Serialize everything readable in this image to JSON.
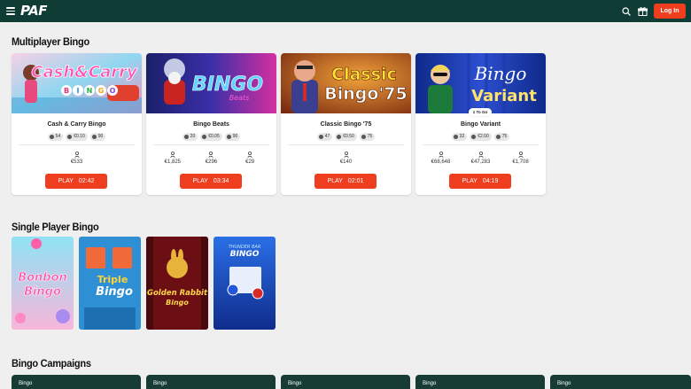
{
  "header": {
    "logo_text": "PAF",
    "login_label": "Log In",
    "icons": [
      "menu-icon",
      "search-icon",
      "gift-icon"
    ]
  },
  "sections": {
    "multiplayer_title": "Multiplayer Bingo",
    "single_title": "Single Player Bingo",
    "campaigns_title": "Bingo Campaigns"
  },
  "multiplayer": [
    {
      "name": "Cash & Carry Bingo",
      "art_text": "Cash & Carry BINGO",
      "players": "54",
      "ticket_price": "€0.10",
      "balls": "90",
      "jackpots": [
        "€533"
      ],
      "play_label": "PLAY",
      "timer": "02:42"
    },
    {
      "name": "Bingo Beats",
      "art_text": "BINGO Beats",
      "players": "20",
      "ticket_price": "€0.05",
      "balls": "90",
      "jackpots": [
        "€1,825",
        "€296",
        "€29"
      ],
      "play_label": "PLAY",
      "timer": "03:34"
    },
    {
      "name": "Classic Bingo '75",
      "art_text": "Classic Bingo '75",
      "players": "47",
      "ticket_price": "€0.50",
      "balls": "75",
      "jackpots": [
        "€140"
      ],
      "play_label": "PLAY",
      "timer": "02:01"
    },
    {
      "name": "Bingo Variant",
      "art_text": "Bingo Variant",
      "badge": "1 To Go",
      "players": "32",
      "ticket_price": "€2.00",
      "balls": "75",
      "jackpots": [
        "€68,648",
        "€47,283",
        "€1,708"
      ],
      "play_label": "PLAY",
      "timer": "04:19"
    }
  ],
  "single_player": [
    {
      "name": "Bonbon Bingo",
      "art_text": "Bonbon Bingo"
    },
    {
      "name": "Triple Bingo",
      "art_text": "Triple Bingo"
    },
    {
      "name": "Golden Rabbit Bingo",
      "art_text": "Golden Rabbit Bingo"
    },
    {
      "name": "Thunder Bar Bingo",
      "art_text": "THUNDER BAR BINGO"
    }
  ],
  "campaigns": [
    {
      "label": "Bingo"
    },
    {
      "label": "Bingo"
    },
    {
      "label": "Bingo"
    },
    {
      "label": "Bingo"
    },
    {
      "label": "Bingo"
    }
  ],
  "colors": {
    "header_bg": "#0f3d35",
    "accent": "#ee3e1f",
    "page_bg": "#efefef"
  }
}
